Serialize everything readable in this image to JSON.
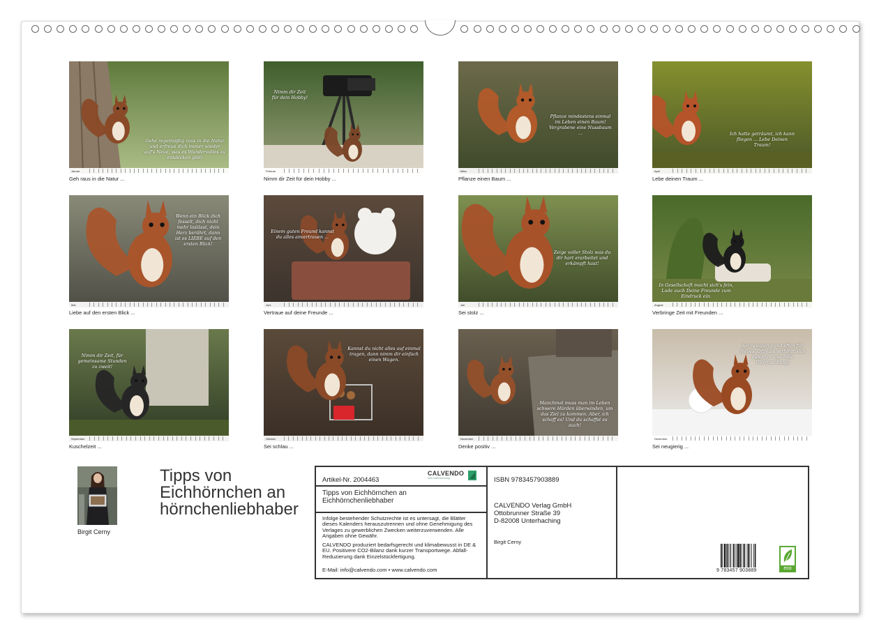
{
  "calendar": {
    "months": [
      {
        "label": "Januar",
        "caption": "Geh raus in die Natur ...",
        "quote": "Gehe regelmäßig raus in die Natur und erfreue dich immer wieder auf's Neue, was es Wundervolles zu entdecken gibt!",
        "days": 31
      },
      {
        "label": "Februar",
        "caption": "Nimm dir Zeit für dein Hobby ...",
        "quote": "Nimm dir Zeit für dein Hobby!",
        "days": 28
      },
      {
        "label": "März",
        "caption": "Pflanze einen Baum ...",
        "quote": "Pflanze mindestens einmal im Leben einen Baum! Vergrabene eine Nussbaum ...",
        "days": 31
      },
      {
        "label": "April",
        "caption": "Lebe deinen Traum ...",
        "quote": "Ich hatte geträumt, ich kann fliegen ... Lebe Deinen Traum!",
        "days": 30
      },
      {
        "label": "Mai",
        "caption": "Liebe auf den ersten Blick ...",
        "quote": "Wenn ein Blick dich fesselt, dich nicht mehr loslässt, dein Herz berührt, dann ist es LIEBE auf den ersten Blick!",
        "days": 31
      },
      {
        "label": "Juni",
        "caption": "Vertraue auf deine Freunde ...",
        "quote": "Einem guten Freund kannst du alles anvertrauen ...",
        "days": 30
      },
      {
        "label": "Juli",
        "caption": "Sei stolz ...",
        "quote": "Zeige voller Stolz was du dir hart erarbeitet und erkämpft hast!",
        "days": 31
      },
      {
        "label": "August",
        "caption": "Verbringe Zeit mit Freunden ...",
        "quote": "In Gesellschaft macht sich's fein, Lade auch Deine Freunde zum Eindruck ein.",
        "days": 31
      },
      {
        "label": "September",
        "caption": "Kuschelzeit ...",
        "quote": "Nimm dir Zeit, für gemeinsame Stunden zu zweit!",
        "days": 30
      },
      {
        "label": "Oktober",
        "caption": "Sei schlau ...",
        "quote": "Kannst du nicht alles auf einmal tragen, dann nimm dir einfach einen Wagen.",
        "days": 31
      },
      {
        "label": "November",
        "caption": "Denke positiv ...",
        "quote": "Manchmal muss man im Leben schwere Hürden überwinden, um das Ziel zu kommen. Aber, ich schaff es! Und du schaffst es auch!",
        "days": 30
      },
      {
        "label": "Dezember",
        "caption": "Sei neugierig ...",
        "quote": "Sei neugierig und offen für Neues. Oftmals verbirgt sich dahinter eine tolle Überraschung!",
        "days": 31
      }
    ]
  },
  "author": {
    "name": "Birgit Cerny"
  },
  "title": "Tipps von Eichhörnchen an hörnchenliebhaber",
  "infobox": {
    "article_number": "Artikel-Nr. 2004463",
    "brand": "CALVENDO",
    "brand_tagline": "Dein Kalenderverlag",
    "subtitle": "Tipps von Eichhörnchen an Eichhörnchenliebhaber",
    "legal_1": "Infolge bestehender Schutzrechte ist es untersagt, die Blätter dieses Kalenders herauszutrennen und ohne Genehmigung des Verlages zu gewerblichen Zwecken weiterzuverwenden. Alle Angaben ohne Gewähr.",
    "legal_2": "CALVENDO produziert bedarfsgerecht und klimabewusst in DE & EU. Positivere CO2-Bilanz dank kurzer Transportwege. Abfall-Reduzierung dank Einzelstückfertigung.",
    "contact": "E-Mail: info@calvendo.com • www.calvendo.com",
    "isbn": "ISBN 9783457903889",
    "publisher": [
      "CALVENDO Verlag GmbH",
      "Ottobrunner Straße 39",
      "D-82008 Unterhaching"
    ],
    "author": "Birgit Cerny",
    "barcode_digits": "9 783457 903889",
    "eco_label": "eco"
  },
  "colors": {
    "brand_green": "#2e9e6a",
    "eco_green": "#5aa832"
  }
}
